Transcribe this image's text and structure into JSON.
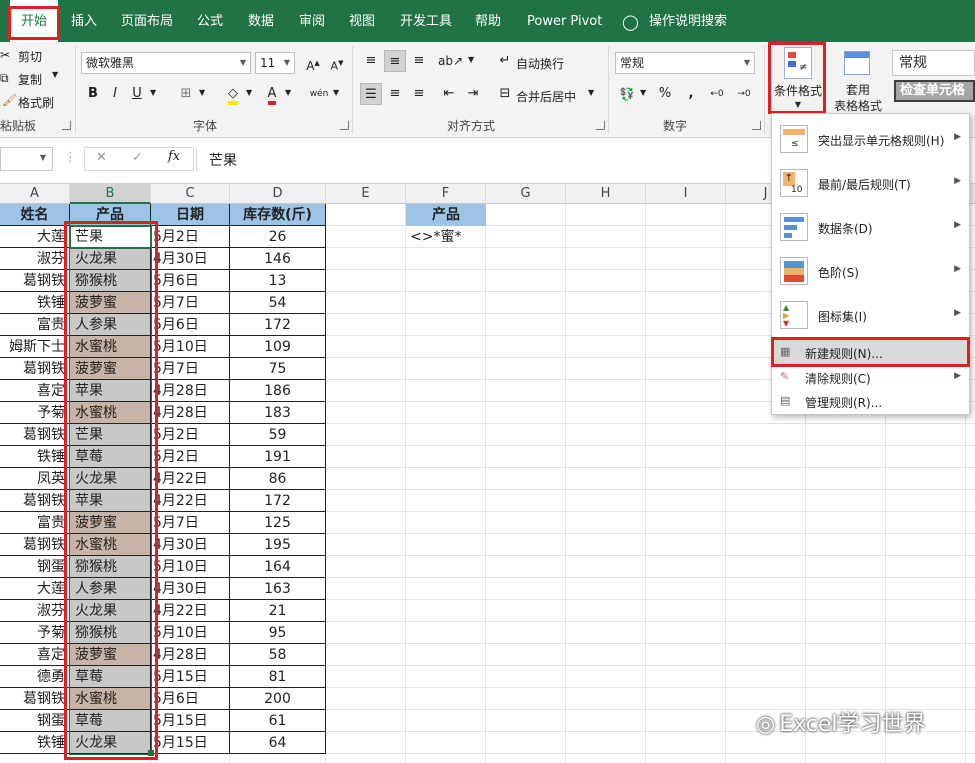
{
  "tabs": [
    "开始",
    "插入",
    "页面布局",
    "公式",
    "数据",
    "审阅",
    "视图",
    "开发工具",
    "帮助",
    "Power Pivot",
    "操作说明搜索"
  ],
  "clipboard": {
    "cut": "剪切",
    "copy": "复制",
    "format_painter": "格式刷",
    "group_label": "粘贴板"
  },
  "font": {
    "name": "微软雅黑",
    "size": "11",
    "bold": "B",
    "italic": "I",
    "underline": "U",
    "phonetic": "wén",
    "group_label": "字体"
  },
  "alignment": {
    "wrap_text": "自动换行",
    "merge_center": "合并后居中",
    "group_label": "对齐方式"
  },
  "number": {
    "format": "常规",
    "percent": "%",
    "comma": ",",
    "group_label": "数字"
  },
  "styles": {
    "conditional_format": "条件格式",
    "table_format_line1": "套用",
    "table_format_line2": "表格格式",
    "style_normal": "常规",
    "style_check_cell": "检查单元格"
  },
  "formula_bar": {
    "cancel": "✕",
    "enter": "✓",
    "fx": "fx",
    "content": "芒果"
  },
  "columns": [
    "A",
    "B",
    "C",
    "D",
    "E",
    "F",
    "G",
    "H",
    "I",
    "J"
  ],
  "table": {
    "headers": [
      "姓名",
      "产品",
      "日期",
      "库存数(斤)"
    ],
    "rows": [
      [
        "大莲",
        "芒果",
        "5月2日",
        "26"
      ],
      [
        "淑芬",
        "火龙果",
        "4月30日",
        "146"
      ],
      [
        "葛钢铁",
        "猕猴桃",
        "5月6日",
        "13"
      ],
      [
        "铁锤",
        "菠萝蜜",
        "5月7日",
        "54"
      ],
      [
        "富贵",
        "人参果",
        "5月6日",
        "172"
      ],
      [
        "姆斯下士",
        "水蜜桃",
        "5月10日",
        "109"
      ],
      [
        "葛钢铁",
        "菠萝蜜",
        "5月7日",
        "75"
      ],
      [
        "喜定",
        "苹果",
        "4月28日",
        "186"
      ],
      [
        "予菊",
        "水蜜桃",
        "4月28日",
        "183"
      ],
      [
        "葛钢铁",
        "芒果",
        "5月2日",
        "59"
      ],
      [
        "铁锤",
        "草莓",
        "5月2日",
        "191"
      ],
      [
        "凤英",
        "火龙果",
        "4月22日",
        "86"
      ],
      [
        "葛钢铁",
        "苹果",
        "4月22日",
        "172"
      ],
      [
        "富贵",
        "菠萝蜜",
        "5月7日",
        "125"
      ],
      [
        "葛钢铁",
        "水蜜桃",
        "4月30日",
        "195"
      ],
      [
        "钢蛋",
        "猕猴桃",
        "5月10日",
        "164"
      ],
      [
        "大莲",
        "人参果",
        "4月30日",
        "163"
      ],
      [
        "淑芬",
        "火龙果",
        "4月22日",
        "21"
      ],
      [
        "予菊",
        "猕猴桃",
        "5月10日",
        "95"
      ],
      [
        "喜定",
        "菠萝蜜",
        "4月28日",
        "58"
      ],
      [
        "德勇",
        "草莓",
        "5月15日",
        "81"
      ],
      [
        "葛钢铁",
        "水蜜桃",
        "5月6日",
        "200"
      ],
      [
        "钢蛋",
        "草莓",
        "5月15日",
        "61"
      ],
      [
        "铁锤",
        "火龙果",
        "5月15日",
        "64"
      ]
    ]
  },
  "criteria": {
    "header": "产品",
    "value": "<>*蜜*"
  },
  "cond_menu": {
    "items": [
      "突出显示单元格规则(H)",
      "最前/最后规则(T)",
      "数据条(D)",
      "色阶(S)",
      "图标集(I)",
      "新建规则(N)...",
      "清除规则(C)",
      "管理规则(R)..."
    ]
  },
  "watermark": "Excel学习世界",
  "colors": {
    "ribbon_green": "#217346",
    "header_fill": "#9dc3e6",
    "highlight_gray": "#c8c8c8",
    "highlight_tan": "#c8b4a6",
    "annotation_red": "#e02020"
  }
}
